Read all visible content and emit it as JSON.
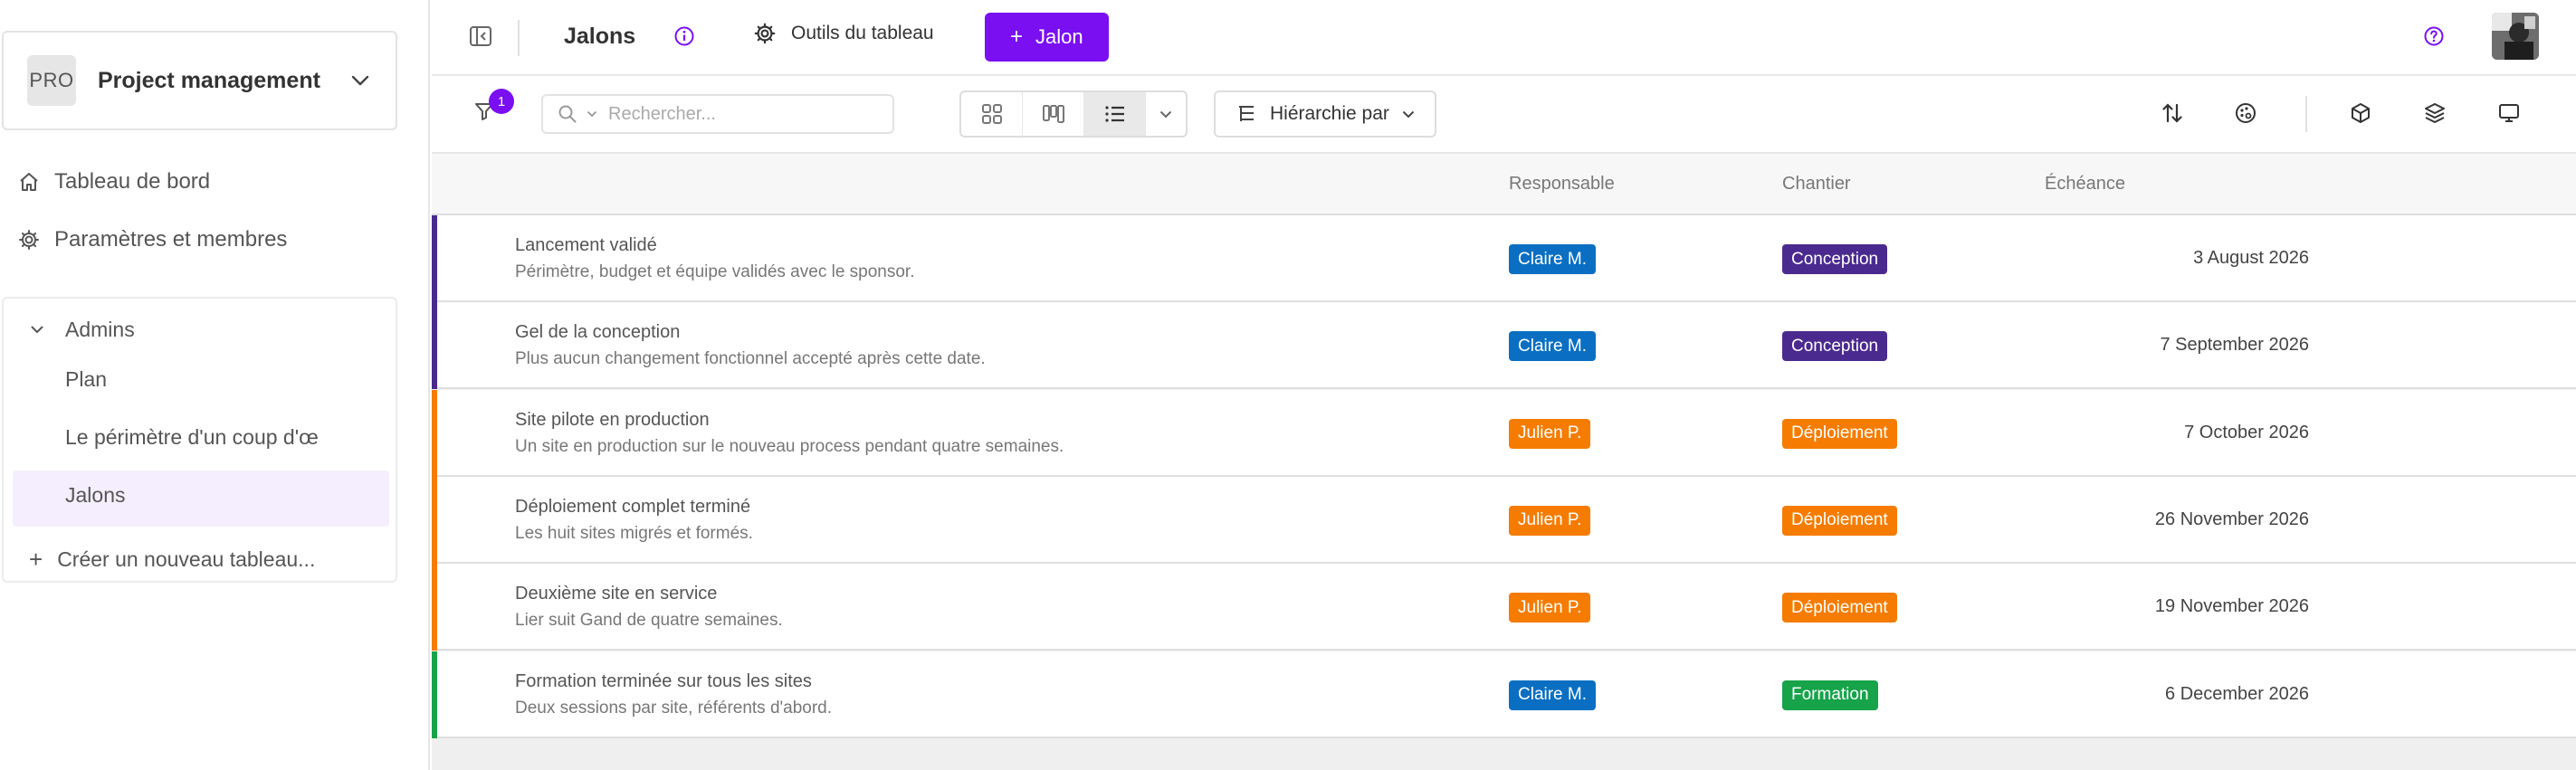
{
  "workspace": {
    "badge": "PRO",
    "name": "Project management"
  },
  "sidebar": {
    "nav": [
      {
        "label": "Tableau de bord",
        "icon": "home-icon"
      },
      {
        "label": "Paramètres et membres",
        "icon": "gear-icon"
      }
    ],
    "group": {
      "label": "Admins"
    },
    "boards": [
      {
        "label": "Plan"
      },
      {
        "label": "Le périmètre d'un coup d'œ"
      },
      {
        "label": "Jalons",
        "active": true
      }
    ],
    "create_label": "Créer un nouveau tableau..."
  },
  "topbar": {
    "title": "Jalons",
    "tools_label": "Outils du tableau",
    "add_label": "Jalon"
  },
  "toolbar": {
    "filter_count": "1",
    "search_placeholder": "Rechercher...",
    "hierarchy_label": "Hiérarchie par"
  },
  "table": {
    "columns": {
      "responsable": "Responsable",
      "chantier": "Chantier",
      "echeance": "Échéance"
    },
    "rows": [
      {
        "name": "Lancement validé",
        "desc": "Périmètre, budget et équipe validés avec le sponsor.",
        "owner": "Claire M.",
        "phase": "Conception",
        "date": "3 August 2026",
        "bar_color": "#4b2a8f",
        "owner_color": "#0a6fc2",
        "phase_color": "#4b2a8f"
      },
      {
        "name": "Gel de la conception",
        "desc": "Plus aucun changement fonctionnel accepté après cette date.",
        "owner": "Claire M.",
        "phase": "Conception",
        "date": "7 September 2026",
        "bar_color": "#4b2a8f",
        "owner_color": "#0a6fc2",
        "phase_color": "#4b2a8f"
      },
      {
        "name": "Site pilote en production",
        "desc": "Un site en production sur le nouveau process pendant quatre semaines.",
        "owner": "Julien P.",
        "phase": "Déploiement",
        "date": "7 October 2026",
        "bar_color": "#f57c00",
        "owner_color": "#f57c00",
        "phase_color": "#f57c00"
      },
      {
        "name": "Déploiement complet terminé",
        "desc": "Les huit sites migrés et formés.",
        "owner": "Julien P.",
        "phase": "Déploiement",
        "date": "26 November 2026",
        "bar_color": "#f57c00",
        "owner_color": "#f57c00",
        "phase_color": "#f57c00"
      },
      {
        "name": "Deuxième site en service",
        "desc": "Lier suit Gand de quatre semaines.",
        "owner": "Julien P.",
        "phase": "Déploiement",
        "date": "19 November 2026",
        "bar_color": "#f57c00",
        "owner_color": "#f57c00",
        "phase_color": "#f57c00"
      },
      {
        "name": "Formation terminée sur tous les sites",
        "desc": "Deux sessions par site, référents d'abord.",
        "owner": "Claire M.",
        "phase": "Formation",
        "date": "6 December 2026",
        "bar_color": "#16a34a",
        "owner_color": "#0a6fc2",
        "phase_color": "#16a34a"
      }
    ]
  },
  "colors": {
    "accent": "#7a0ff2",
    "sidebar_active_bg": "#f4eefe"
  }
}
